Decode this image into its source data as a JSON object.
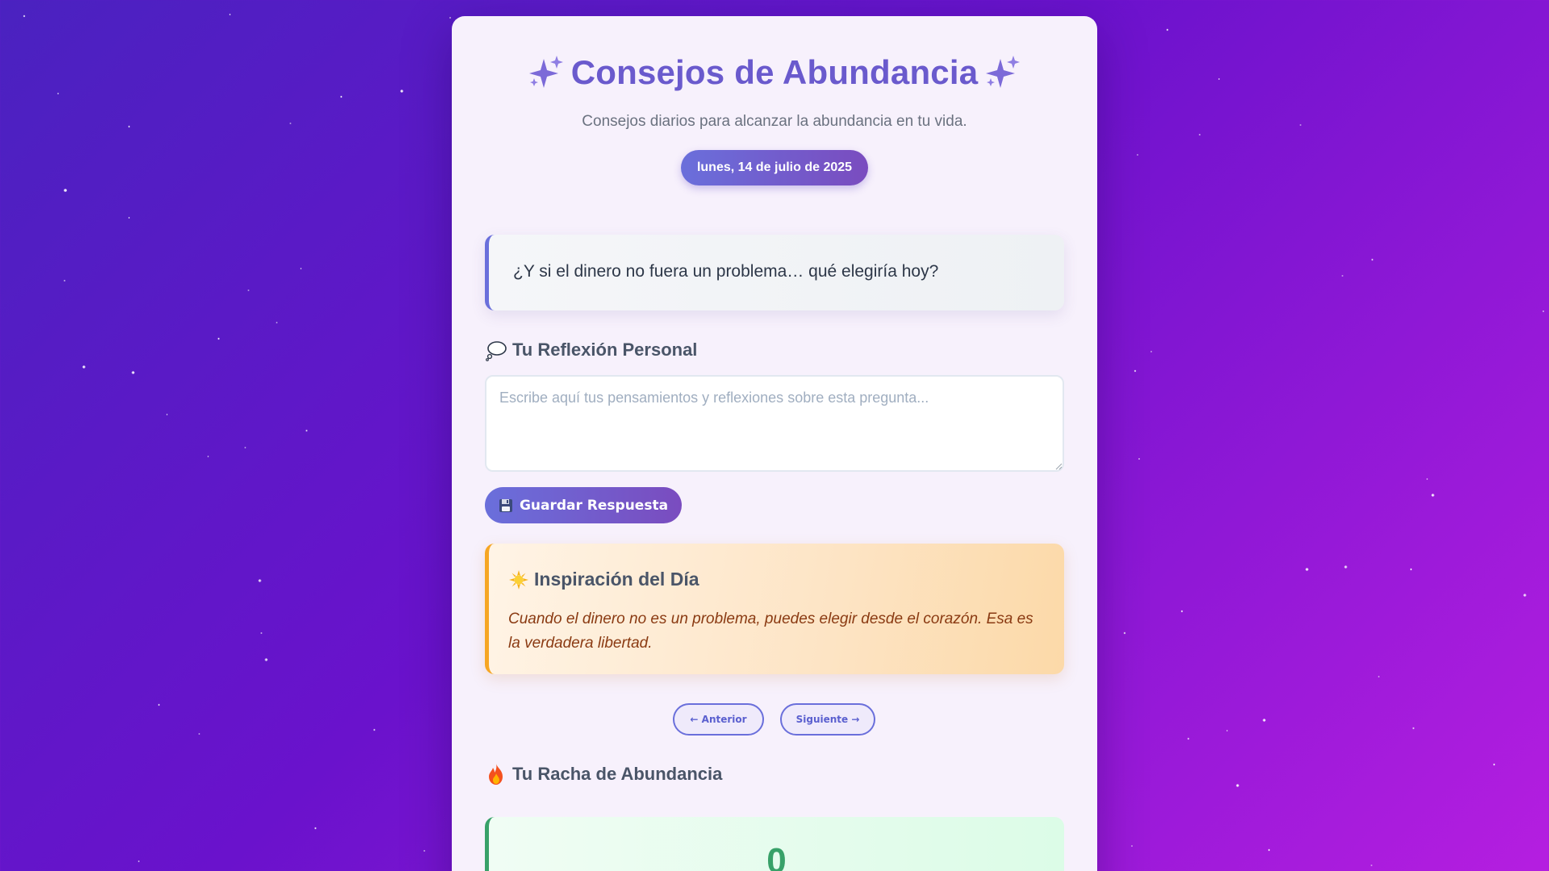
{
  "header": {
    "title": "Consejos de Abundancia",
    "subtitle": "Consejos diarios para alcanzar la abundancia en tu vida.",
    "date": "lunes, 14 de julio de 2025"
  },
  "question": {
    "text": "¿Y si el dinero no fuera un problema… qué elegiría hoy?"
  },
  "reflection": {
    "title": "Tu Reflexión Personal",
    "placeholder": "Escribe aquí tus pensamientos y reflexiones sobre esta pregunta...",
    "value": "",
    "save_label": "Guardar Respuesta"
  },
  "inspiration": {
    "title": "Inspiración del Día",
    "text": "Cuando el dinero no es un problema, puedes elegir desde el corazón. Esa es la verdadera libertad."
  },
  "navigation": {
    "prev_label": "← Anterior",
    "next_label": "Siguiente →"
  },
  "streak": {
    "title": "Tu Racha de Abundancia",
    "count": "0"
  },
  "icons": {
    "title_left": "sparkles-icon",
    "title_right": "sparkles-icon",
    "reflection": "thought-bubble-icon",
    "save": "floppy-disk-icon",
    "inspiration": "sun-icon",
    "streak": "fire-icon"
  },
  "colors": {
    "accent": "#6a5acd",
    "gradient_start": "#6a6fdb",
    "gradient_end": "#7a4cbf",
    "inspiration_border": "#f6a623",
    "streak_green": "#38a169"
  }
}
